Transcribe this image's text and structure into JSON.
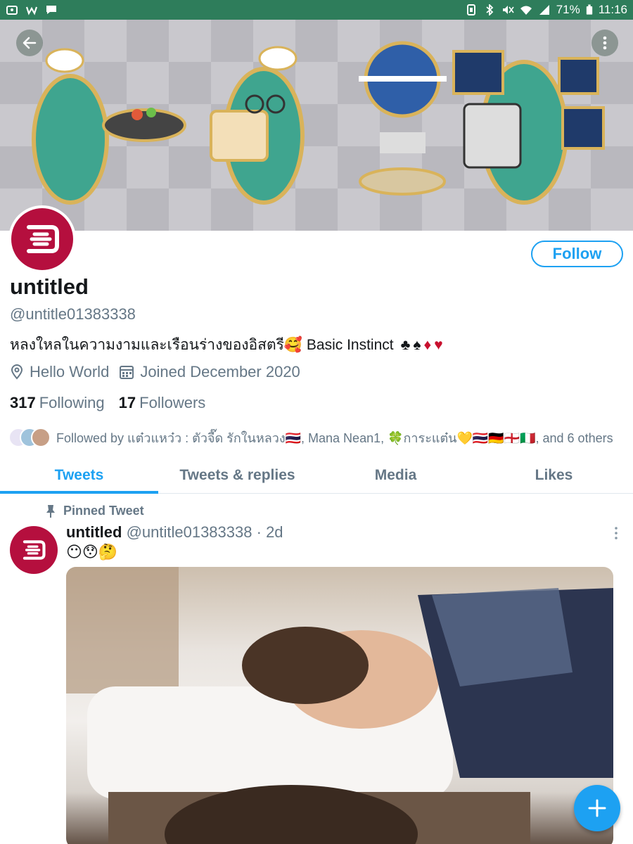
{
  "status_bar": {
    "battery": "71%",
    "time": "11:16"
  },
  "header": {
    "back_icon": "arrow-left-icon",
    "more_icon": "vertical-dots-icon"
  },
  "profile": {
    "name": "untitled",
    "handle": "@untitle01383338",
    "bio_text": "หลงใหลในความงามและเรือนร่างของอิสตรี🥰 Basic Instinct",
    "bio_suits": [
      "♣",
      "♠",
      "♦",
      "♥"
    ],
    "location": "Hello World",
    "joined": "Joined December 2020",
    "following_count": "317",
    "following_label": "Following",
    "followers_count": "17",
    "followers_label": "Followers",
    "followed_by": "Followed by แต๋วแหว๋ว : ตัวจี๊ด รักในหลวง🇹🇭, Mana Nean1, 🍀การะแต๋น💛🇹🇭🇩🇪🏴󠁧󠁢󠁥󠁮󠁧󠁿🇮🇹, and 6 others",
    "follow_button": "Follow",
    "accent_color": "#1da1f2",
    "avatar_color": "#b50f3e"
  },
  "tabs": [
    {
      "label": "Tweets",
      "active": true
    },
    {
      "label": "Tweets & replies",
      "active": false
    },
    {
      "label": "Media",
      "active": false
    },
    {
      "label": "Likes",
      "active": false
    }
  ],
  "tweet": {
    "pinned_label": "Pinned Tweet",
    "name": "untitled",
    "handle": "@untitle01383338",
    "separator": "·",
    "age": "2d",
    "text": "😶😯🤔"
  },
  "fab": {
    "icon": "plus-icon"
  }
}
